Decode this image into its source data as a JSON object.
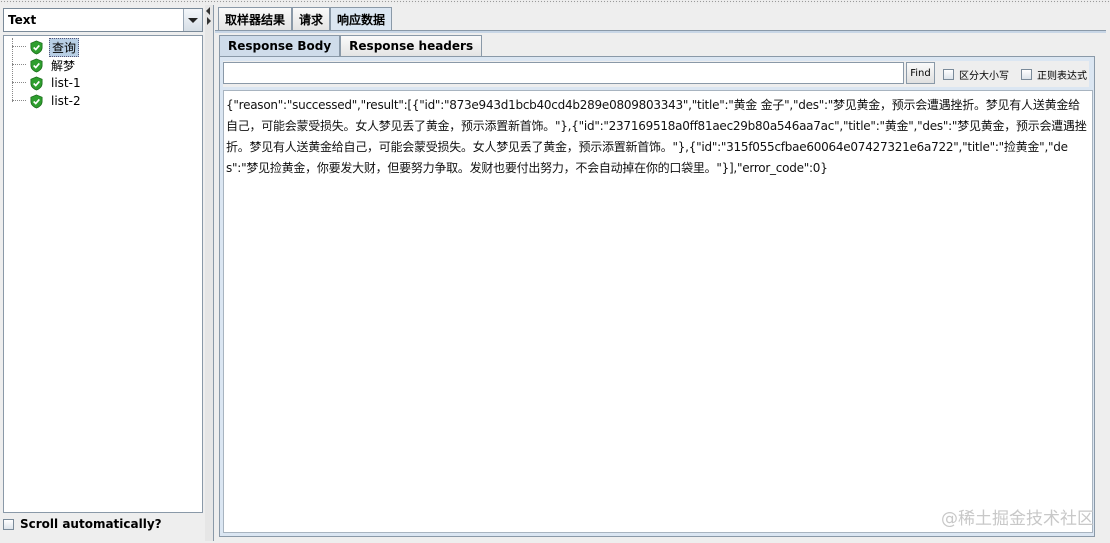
{
  "left_panel": {
    "renderer_selected": "Text",
    "tree_items": [
      {
        "label": "查询",
        "selected": true,
        "icon": "success-shield-icon"
      },
      {
        "label": "解梦",
        "selected": false,
        "icon": "success-shield-icon"
      },
      {
        "label": "list-1",
        "selected": false,
        "icon": "success-shield-icon"
      },
      {
        "label": "list-2",
        "selected": false,
        "icon": "success-shield-icon"
      }
    ],
    "scroll_auto_label": "Scroll automatically?"
  },
  "right_panel": {
    "top_tabs": [
      {
        "label": "取样器结果",
        "active": false
      },
      {
        "label": "请求",
        "active": false
      },
      {
        "label": "响应数据",
        "active": true
      }
    ],
    "sub_tabs": [
      {
        "label": "Response Body",
        "active": true
      },
      {
        "label": "Response headers",
        "active": false
      }
    ],
    "search": {
      "value": "",
      "find_label": "Find",
      "case_sensitive_label": "区分大小写",
      "regex_label": "正则表达式"
    },
    "response_body": "{\"reason\":\"successed\",\"result\":[{\"id\":\"873e943d1bcb40cd4b289e0809803343\",\"title\":\"黄金 金子\",\"des\":\"梦见黄金，预示会遭遇挫折。梦见有人送黄金给自己，可能会蒙受损失。女人梦见丢了黄金，预示添置新首饰。\"},{\"id\":\"237169518a0ff81aec29b80a546aa7ac\",\"title\":\"黄金\",\"des\":\"梦见黄金，预示会遭遇挫折。梦见有人送黄金给自己，可能会蒙受损失。女人梦见丢了黄金，预示添置新首饰。\"},{\"id\":\"315f055cfbae60064e07427321e6a722\",\"title\":\"捡黄金\",\"des\":\"梦见捡黄金，你要发大财，但要努力争取。发财也要付出努力，不会自动掉在你的口袋里。\"}],\"error_code\":0}"
  },
  "watermark": "@稀土掘金技术社区",
  "colors": {
    "success_green": "#2e9e2e",
    "selection_bg": "#b8cfe5",
    "tab_active": "#dbe6f2"
  }
}
